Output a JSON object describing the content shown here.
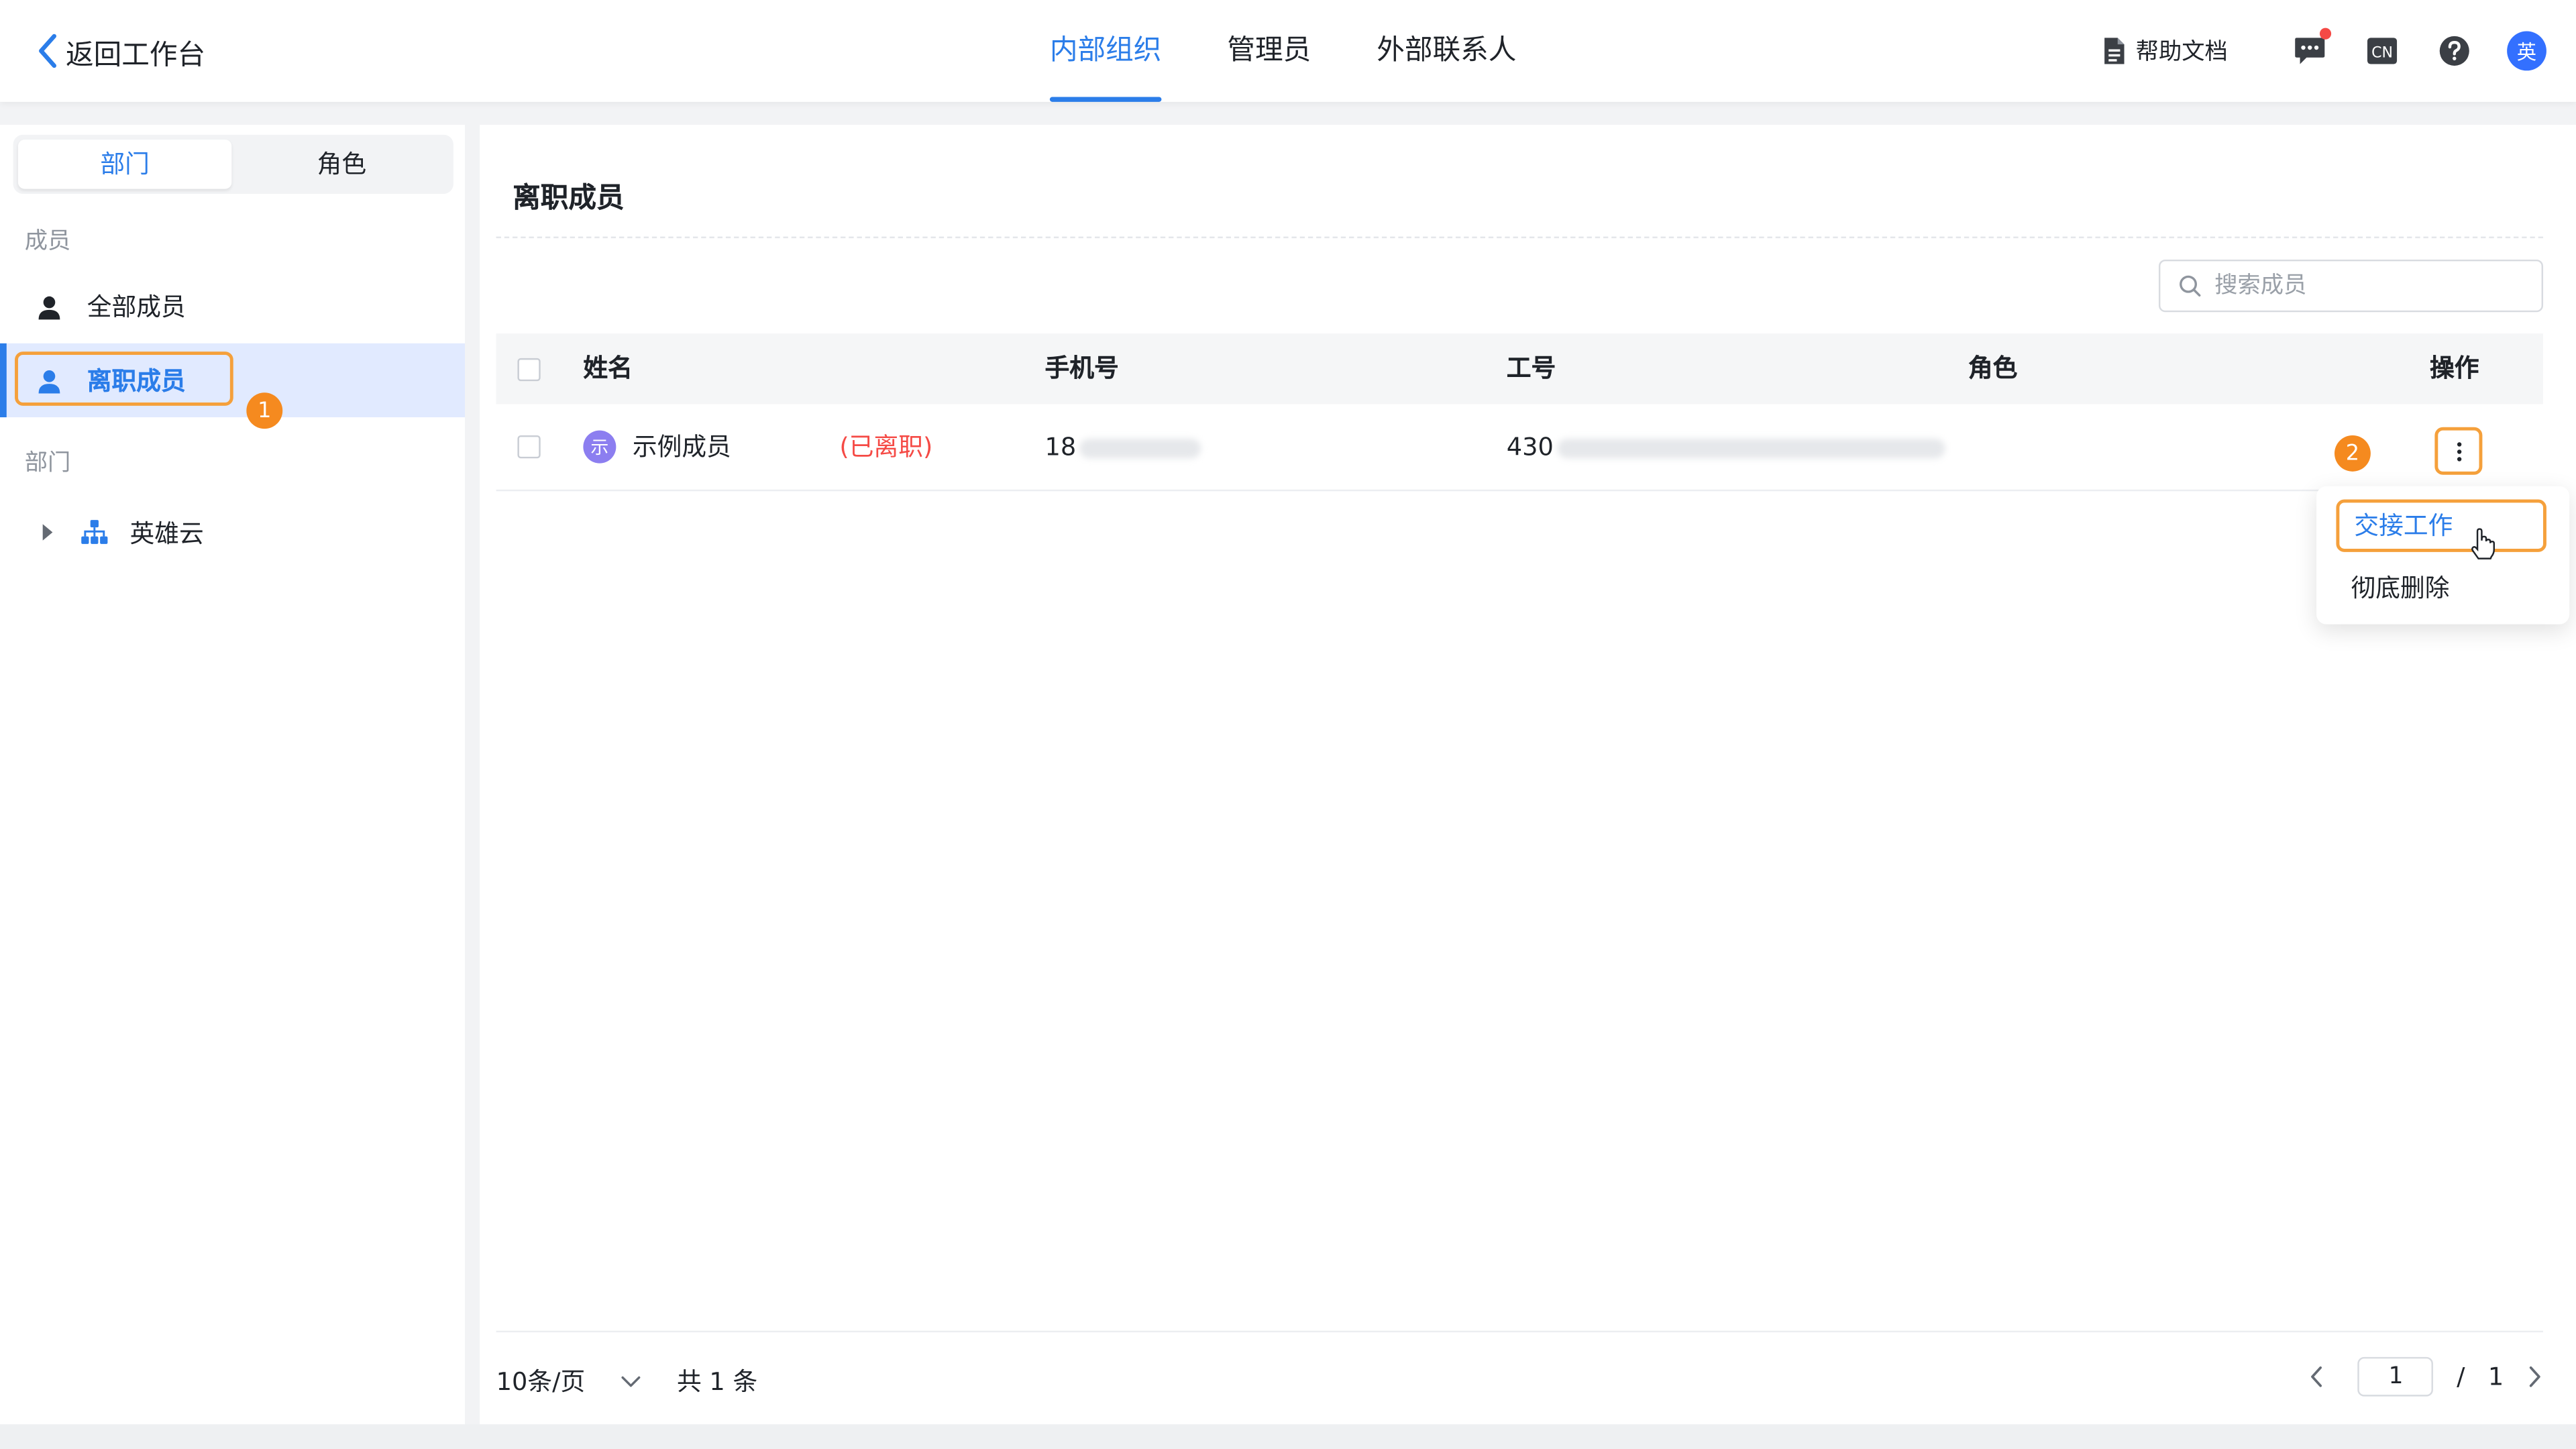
{
  "header": {
    "back_label": "返回工作台",
    "tabs": [
      {
        "label": "内部组织",
        "active": true
      },
      {
        "label": "管理员",
        "active": false
      },
      {
        "label": "外部联系人",
        "active": false
      }
    ],
    "help_doc_label": "帮助文档",
    "language_icon_text": "CN",
    "avatar_text": "英",
    "icons": [
      "document-icon",
      "message-icon",
      "language-icon",
      "help-icon"
    ]
  },
  "sidebar": {
    "segments": [
      "部门",
      "角色"
    ],
    "active_segment": "部门",
    "members_section_label": "成员",
    "members": [
      {
        "label": "全部成员",
        "icon": "user-icon",
        "selected": false
      },
      {
        "label": "离职成员",
        "icon": "user-icon",
        "selected": true
      }
    ],
    "departments_section_label": "部门",
    "departments": [
      {
        "label": "英雄云",
        "icon": "org-tree-icon",
        "collapsed": true
      }
    ],
    "step_marker": "1"
  },
  "main": {
    "title": "离职成员",
    "search": {
      "placeholder": "搜索成员",
      "value": ""
    },
    "table": {
      "columns": [
        "姓名",
        "手机号",
        "工号",
        "角色",
        "操作"
      ],
      "rows": [
        {
          "avatar": "示",
          "name": "示例成员",
          "status": "(已离职)",
          "phone_visible": "18",
          "employee_id_visible": "430",
          "role": ""
        }
      ]
    },
    "step_marker": "2",
    "row_menu": [
      "交接工作",
      "彻底删除"
    ],
    "footer": {
      "page_size": "10条/页",
      "total": "共 1 条",
      "current_page": "1",
      "separator": "/",
      "total_pages": "1"
    }
  },
  "colors": {
    "accent": "#2b7de9",
    "highlight_border": "#f5a03b",
    "step_badge": "#f58a1f",
    "status_red": "#f54a45",
    "selected_bg": "#e1eaff"
  }
}
